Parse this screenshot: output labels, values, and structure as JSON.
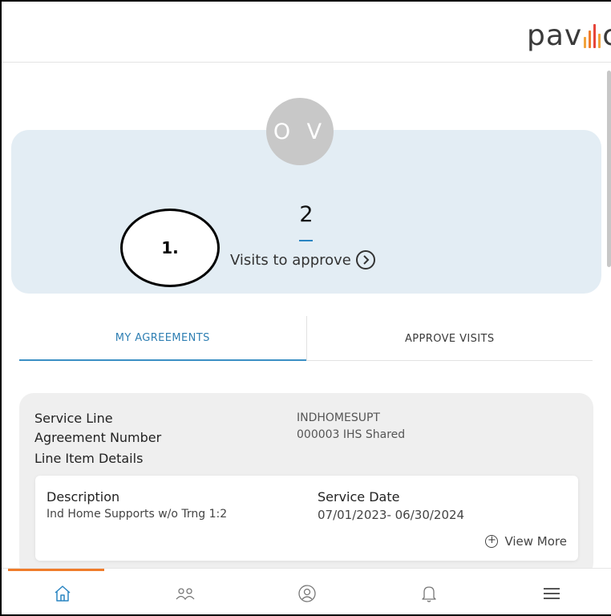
{
  "header": {
    "logo_text_left": "pav",
    "logo_text_right": "c",
    "logo_bar_colors": [
      "#f1a33c",
      "#f07c2a",
      "#e6453a",
      "#f1a33c"
    ]
  },
  "summary": {
    "avatar_initials": "O V",
    "visit_count": "2",
    "visits_label": "Visits to approve",
    "callout_label": "1."
  },
  "tabs": [
    {
      "label": "MY AGREEMENTS",
      "active": true
    },
    {
      "label": "APPROVE VISITS",
      "active": false
    }
  ],
  "agreement": {
    "service_line_label": "Service Line",
    "service_line_value": "INDHOMESUPT",
    "agreement_number_label": "Agreement Number",
    "agreement_number_value": "000003 IHS Shared",
    "line_item_label": "Line Item Details",
    "detail": {
      "description_label": "Description",
      "description_value": "Ind Home Supports w/o Trng 1:2",
      "service_date_label": "Service Date",
      "service_date_value": "07/01/2023- 06/30/2024",
      "view_more_label": "View More"
    }
  },
  "bottom_nav": {
    "items": [
      "home-icon",
      "people-icon",
      "user-circle-icon",
      "bell-icon",
      "menu-icon"
    ],
    "active_index": 0,
    "accent_color": "#f07c2a",
    "active_icon_color": "#2a85c2"
  }
}
